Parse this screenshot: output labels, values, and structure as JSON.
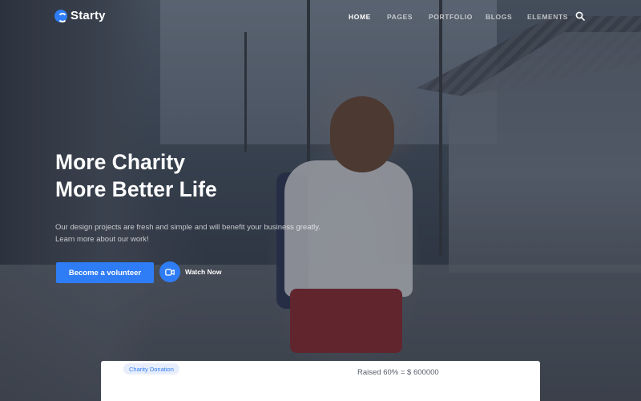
{
  "brand": {
    "name": "Starty",
    "accent": "#2f7df6"
  },
  "nav": {
    "items": [
      {
        "label": "HOME",
        "active": true
      },
      {
        "label": "PAGES",
        "active": false
      },
      {
        "label": "PORTFOLIO",
        "active": false
      },
      {
        "label": "BLOGS",
        "active": false
      },
      {
        "label": "ELEMENTS",
        "active": false
      }
    ],
    "search_icon": "search-icon"
  },
  "hero": {
    "headline_line1": "More Charity",
    "headline_line2": "More Better Life",
    "subtext": "Our design projects are fresh and simple and will benefit your business greatly. Learn more about our work!",
    "primary_button": "Become a volunteer",
    "watch_label": "Watch Now",
    "watch_icon": "video-camera-icon"
  },
  "donation": {
    "badge": "Charity Donation",
    "raised": "Raised 60% = $ 600000"
  }
}
